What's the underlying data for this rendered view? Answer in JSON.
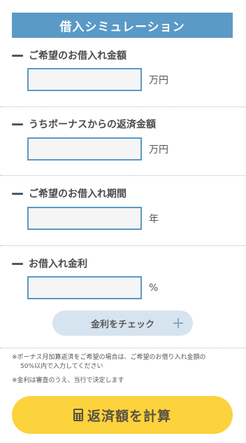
{
  "header": {
    "title": "借入シミュレーション"
  },
  "fields": [
    {
      "label": "ご希望のお借入れ金額",
      "value": "",
      "unit": "万円"
    },
    {
      "label": "うちボーナスからの返済金額",
      "value": "",
      "unit": "万円"
    },
    {
      "label": "ご希望のお借入れ期間",
      "value": "",
      "unit": "年"
    },
    {
      "label": "お借入れ金利",
      "value": "",
      "unit": "%"
    }
  ],
  "check_button": {
    "label": "金利をチェック",
    "icon": "plus-icon"
  },
  "notes": [
    "※ボーナス月加算返済をご希望の場合は、ご希望のお借り入れ金額の",
    "50%以内で入力してください",
    "※金利は審査のうえ、当行で決定します"
  ],
  "calc_button": {
    "label": "返済額を計算",
    "icon": "calculator-icon"
  },
  "colors": {
    "accent": "#5b99c7",
    "cta": "#fcd23d",
    "check_bg": "#d6e4f0"
  }
}
